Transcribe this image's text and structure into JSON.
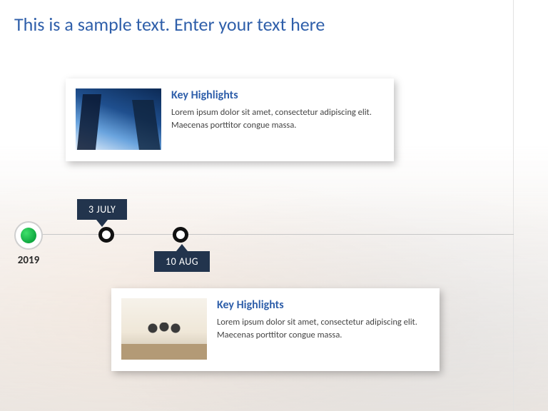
{
  "title": "This is a sample text. Enter your text here",
  "timeline": {
    "start_year": "2019",
    "events": [
      {
        "date_label": "3 JULY",
        "card": {
          "heading": "Key Highlights",
          "body": "Lorem ipsum dolor sit amet, consectetur adipiscing elit. Maecenas porttitor congue massa.",
          "image_alt": "skyscrapers-looking-up"
        }
      },
      {
        "date_label": "10 AUG",
        "card": {
          "heading": "Key Highlights",
          "body": "Lorem ipsum dolor sit amet, consectetur adipiscing elit. Maecenas porttitor congue massa.",
          "image_alt": "team-meeting-in-office"
        }
      }
    ]
  },
  "colors": {
    "accent_blue": "#2f5faa",
    "flag_navy": "#22344d",
    "marker_green": "#0fa73f"
  }
}
